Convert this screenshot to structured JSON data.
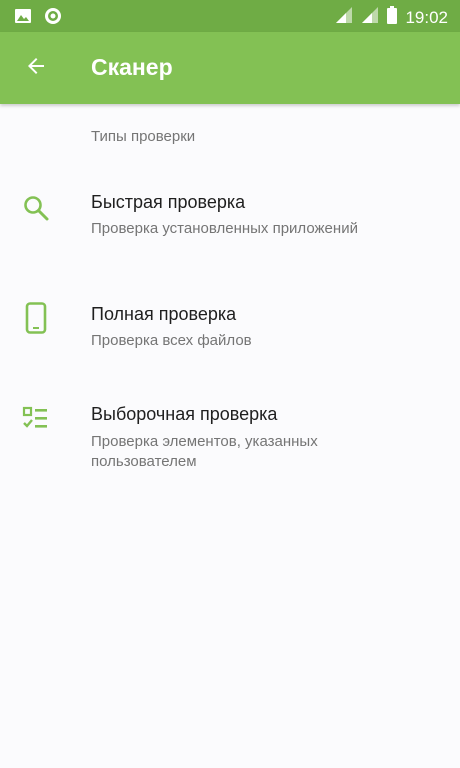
{
  "status_bar": {
    "time": "19:02",
    "icons": [
      "image-icon",
      "app-shield-icon",
      "signal-icon",
      "signal-icon",
      "battery-icon"
    ]
  },
  "app_bar": {
    "back_icon": "arrow-back-icon",
    "title": "Сканер"
  },
  "section": {
    "header": "Типы проверки"
  },
  "scan_types": [
    {
      "icon": "search-icon",
      "title": "Быстрая проверка",
      "description": "Проверка установленных приложений"
    },
    {
      "icon": "phone-icon",
      "title": "Полная проверка",
      "description": "Проверка всех файлов"
    },
    {
      "icon": "checklist-icon",
      "title": "Выборочная проверка",
      "description": "Проверка элементов, указанных пользователем"
    }
  ],
  "colors": {
    "status_bar": "#6fac45",
    "app_bar": "#83c154",
    "accent_icon": "#83c154",
    "background": "#fbfbfd"
  }
}
